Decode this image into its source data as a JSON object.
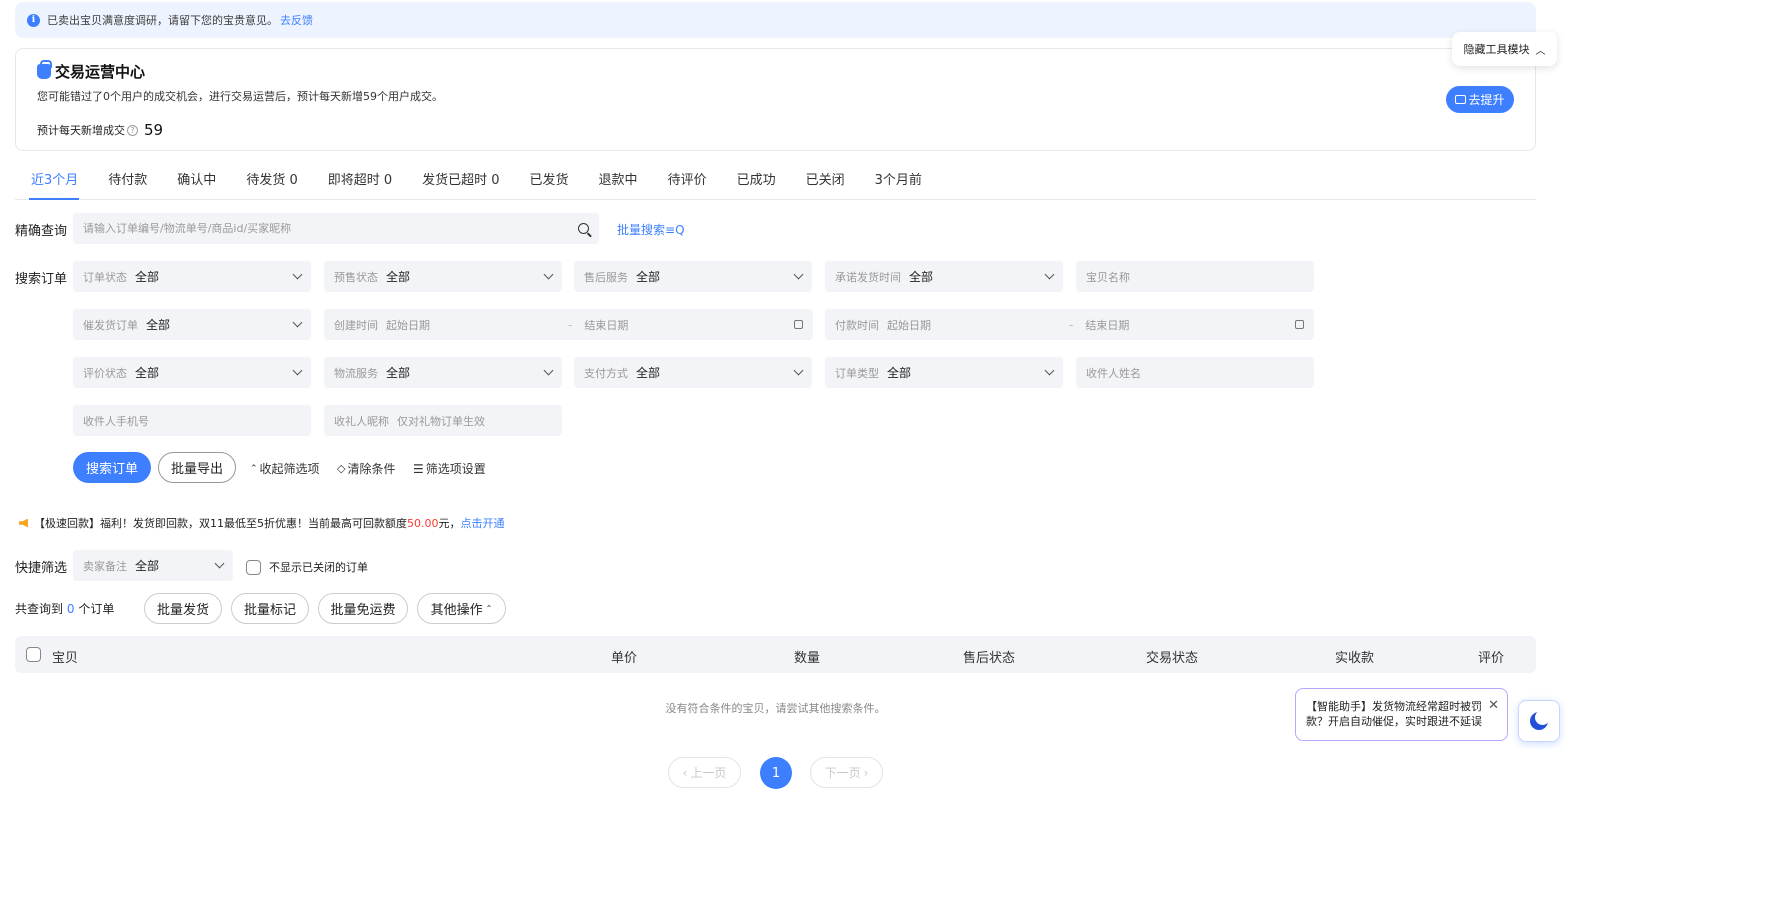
{
  "notice": {
    "text": "已卖出宝贝满意度调研，请留下您的宝贵意见。",
    "link": "去反馈"
  },
  "ops": {
    "title": "交易运营中心",
    "desc": "您可能错过了0个用户的成交机会，进行交易运营后，预计每天新增59个用户成交。",
    "stat_label": "预计每天新增成交",
    "stat_value": "59",
    "boost_label": "去提升"
  },
  "hide_tools": "隐藏工具模块",
  "tabs": [
    {
      "label": "近3个月",
      "active": true
    },
    {
      "label": "待付款"
    },
    {
      "label": "确认中"
    },
    {
      "label": "待发货 0"
    },
    {
      "label": "即将超时 0"
    },
    {
      "label": "发货已超时 0"
    },
    {
      "label": "已发货"
    },
    {
      "label": "退款中"
    },
    {
      "label": "待评价"
    },
    {
      "label": "已成功"
    },
    {
      "label": "已关闭"
    },
    {
      "label": "3个月前"
    }
  ],
  "exact_search": {
    "label": "精确查询",
    "placeholder": "请输入订单编号/物流单号/商品id/买家昵称",
    "batch_label": "批量搜索"
  },
  "search_orders": {
    "label": "搜索订单",
    "order_status": {
      "key": "订单状态",
      "value": "全部"
    },
    "presale_status": {
      "key": "预售状态",
      "value": "全部"
    },
    "after_sale": {
      "key": "售后服务",
      "value": "全部"
    },
    "promise_ship_time": {
      "key": "承诺发货时间",
      "value": "全部"
    },
    "item_name": {
      "placeholder": "宝贝名称"
    },
    "urge_order": {
      "key": "催发货订单",
      "value": "全部"
    },
    "create_time": {
      "key": "创建时间",
      "start": "起始日期",
      "end": "结束日期"
    },
    "pay_time": {
      "key": "付款时间",
      "start": "起始日期",
      "end": "结束日期"
    },
    "review_status": {
      "key": "评价状态",
      "value": "全部"
    },
    "logistics": {
      "key": "物流服务",
      "value": "全部"
    },
    "pay_method": {
      "key": "支付方式",
      "value": "全部"
    },
    "order_type": {
      "key": "订单类型",
      "value": "全部"
    },
    "receiver_name": {
      "placeholder": "收件人姓名"
    },
    "receiver_phone": {
      "placeholder": "收件人手机号"
    },
    "gift_receiver": {
      "key": "收礼人昵称",
      "placeholder": "仅对礼物订单生效"
    }
  },
  "actions": {
    "search": "搜索订单",
    "export": "批量导出",
    "collapse": "收起筛选项",
    "clear": "清除条件",
    "settings": "筛选项设置"
  },
  "promo": {
    "prefix": "【极速回款】福利！发货即回款，双11最低至5折优惠！当前最高可回款额度",
    "amount": "50.00",
    "suffix": "元，",
    "link": "点击开通"
  },
  "quick_filter": {
    "label": "快捷筛选",
    "seller_note": {
      "key": "卖家备注",
      "value": "全部"
    },
    "hide_closed": "不显示已关闭的订单"
  },
  "result": {
    "prefix": "共查询到",
    "count": "0",
    "suffix": "个订单"
  },
  "bulk": [
    "批量发货",
    "批量标记",
    "批量免运费",
    "其他操作"
  ],
  "table": {
    "columns": [
      "宝贝",
      "单价",
      "数量",
      "售后状态",
      "交易状态",
      "实收款",
      "评价"
    ],
    "empty": "没有符合条件的宝贝，请尝试其他搜索条件。"
  },
  "pagination": {
    "prev": "上一页",
    "current": "1",
    "next": "下一页"
  },
  "assistant": {
    "text": "【智能助手】发货物流经常超时被罚款？开启自动催促，实时跟进不延误"
  }
}
